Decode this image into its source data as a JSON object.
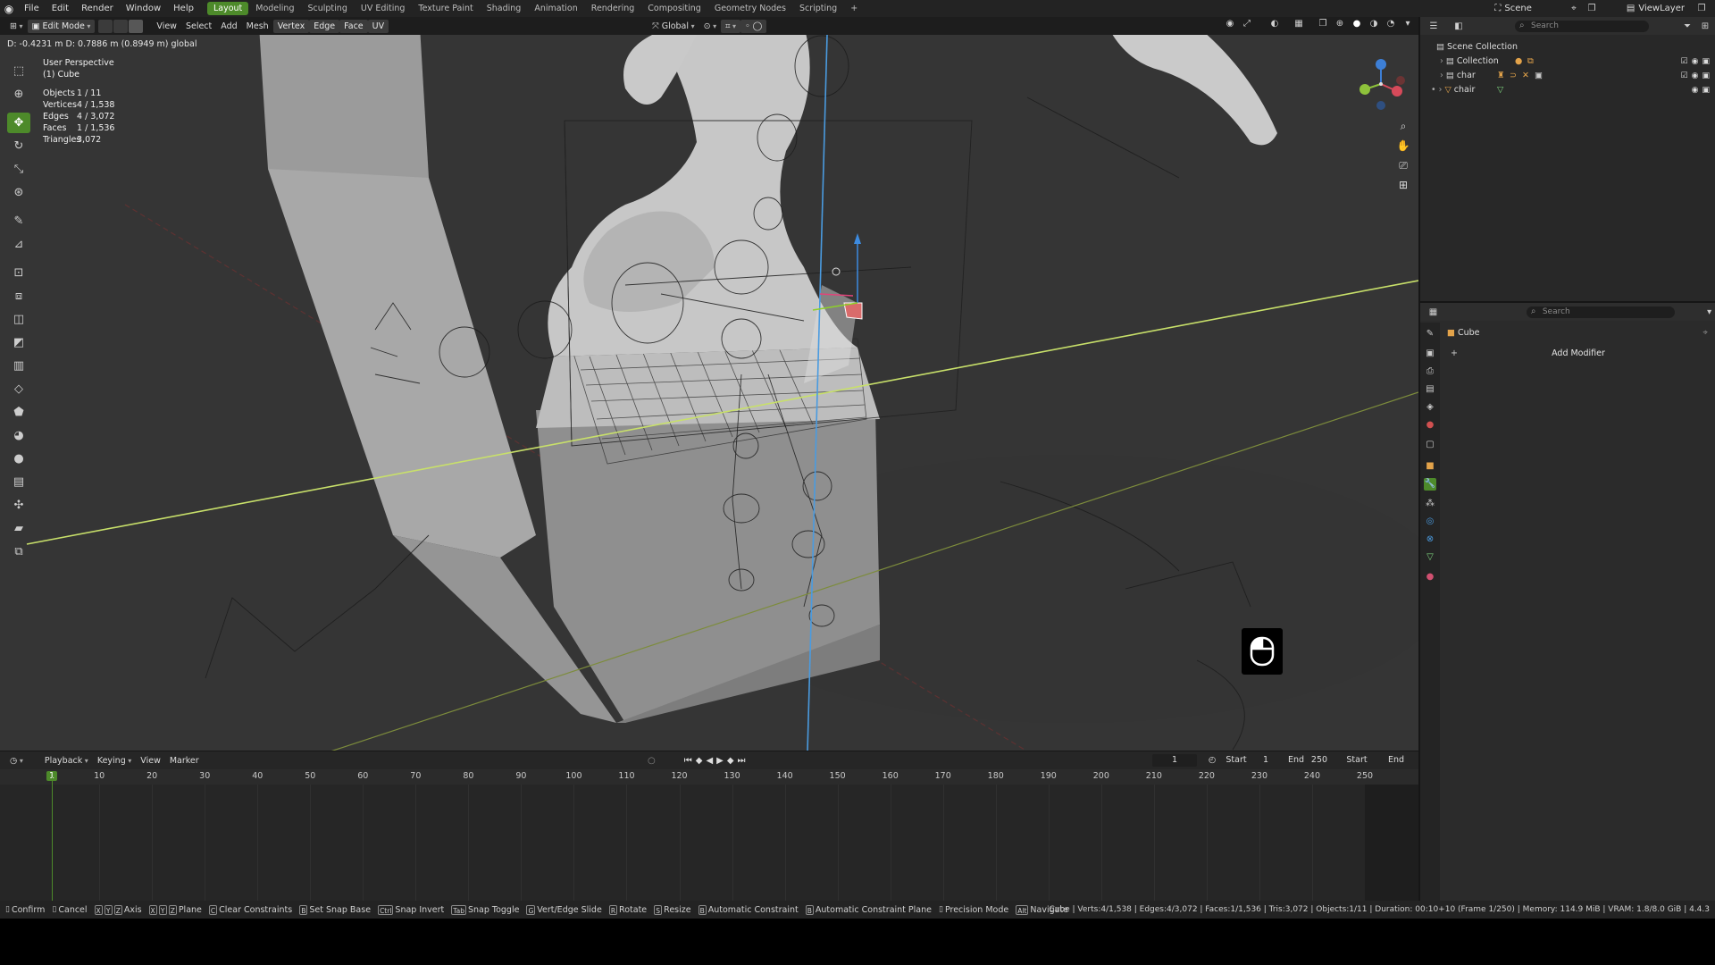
{
  "menu": [
    "File",
    "Edit",
    "Render",
    "Window",
    "Help"
  ],
  "workspaces": [
    "Layout",
    "Modeling",
    "Sculpting",
    "UV Editing",
    "Texture Paint",
    "Shading",
    "Animation",
    "Rendering",
    "Compositing",
    "Geometry Nodes",
    "Scripting"
  ],
  "active_workspace": "Layout",
  "topbar_right": {
    "scene": "Scene",
    "view_layer": "ViewLayer"
  },
  "viewport_header": {
    "mode": "Edit Mode",
    "menus": [
      "View",
      "Select",
      "Add",
      "Mesh",
      "Vertex",
      "Edge",
      "Face",
      "UV"
    ],
    "transform": "Global"
  },
  "transform_readout": "D: -0.4231 m   D: 0.7886 m (0.8949 m) global",
  "overlay": {
    "perspective": "User Perspective",
    "object": "(1) Cube",
    "stats": [
      {
        "k": "Objects",
        "v": "1 / 11"
      },
      {
        "k": "Vertices",
        "v": "4 / 1,538"
      },
      {
        "k": "Edges",
        "v": "4 / 3,072"
      },
      {
        "k": "Faces",
        "v": "1 / 1,536"
      },
      {
        "k": "Triangles",
        "v": "3,072"
      }
    ]
  },
  "timeline": {
    "menus": [
      "Playback",
      "Keying",
      "View",
      "Marker"
    ],
    "current_frame": "1",
    "start_label": "Start",
    "start": "1",
    "end_label": "End",
    "end": "250",
    "right_start": "Start",
    "right_end": "End",
    "ticks": [
      "1",
      "10",
      "20",
      "30",
      "40",
      "50",
      "60",
      "70",
      "80",
      "90",
      "100",
      "110",
      "120",
      "130",
      "140",
      "150",
      "160",
      "170",
      "180",
      "190",
      "200",
      "210",
      "220",
      "230",
      "240",
      "250"
    ]
  },
  "statusbar": {
    "items": [
      {
        "keys": [],
        "label": "Confirm"
      },
      {
        "keys": [],
        "label": "Cancel"
      },
      {
        "keys": [
          "X",
          "Y",
          "Z"
        ],
        "label": "Axis"
      },
      {
        "keys": [
          "X",
          "Y",
          "Z"
        ],
        "label": "Plane"
      },
      {
        "keys": [
          "C"
        ],
        "label": "Clear Constraints"
      },
      {
        "keys": [
          "B"
        ],
        "label": "Set Snap Base"
      },
      {
        "keys": [
          "Ctrl"
        ],
        "label": "Snap Invert"
      },
      {
        "keys": [
          "Tab"
        ],
        "label": "Snap Toggle"
      },
      {
        "keys": [
          "G"
        ],
        "label": "Vert/Edge Slide"
      },
      {
        "keys": [
          "R"
        ],
        "label": "Rotate"
      },
      {
        "keys": [
          "S"
        ],
        "label": "Resize"
      },
      {
        "keys": [
          "B"
        ],
        "label": "Automatic Constraint"
      },
      {
        "keys": [
          "B"
        ],
        "label": "Automatic Constraint Plane"
      },
      {
        "keys": [],
        "label": "Precision Mode"
      },
      {
        "keys": [
          "Alt"
        ],
        "label": "Navigate"
      }
    ],
    "right": "Cube | Verts:4/1,538 | Edges:4/3,072 | Faces:1/1,536 | Tris:3,072 | Objects:1/11 | Duration: 00:10+10 (Frame 1/250) | Memory: 114.9 MiB | VRAM: 1.8/8.0 GiB | 4.4.3"
  },
  "outliner": {
    "search_placeholder": "Search",
    "root": "Scene Collection",
    "items": [
      "Collection",
      "char",
      "chair"
    ]
  },
  "properties": {
    "search_placeholder": "Search",
    "object": "Cube",
    "add_modifier": "Add Modifier"
  },
  "colors": {
    "accent": "#4d8a2a",
    "x_axis": "#c8e06a",
    "z_axis": "#4a9be0",
    "viewport_bg": "#353535"
  }
}
